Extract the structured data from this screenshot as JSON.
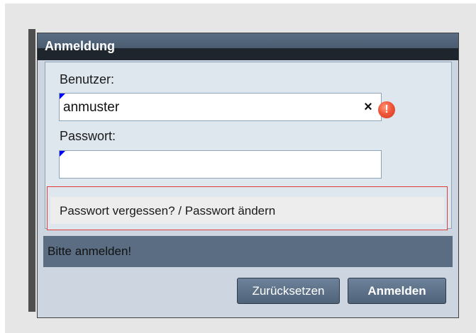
{
  "dialog": {
    "title": "Anmeldung"
  },
  "form": {
    "user_label": "Benutzer:",
    "user_value": "anmuster",
    "clear_icon": "×",
    "error_icon": "!",
    "password_label": "Passwort:",
    "password_value": ""
  },
  "links": {
    "forgot_password": "Passwort vergessen? / Passwort ändern"
  },
  "status": {
    "message": "Bitte anmelden!"
  },
  "buttons": {
    "reset_label": "Zurücksetzen",
    "login_label": "Anmelden"
  },
  "colors": {
    "title_bar": "#4b5c70",
    "status_bar": "#5a6d83",
    "error": "#f0563b",
    "field_marker": "#0000ff",
    "link_box_border": "#e03c3c"
  },
  "icons": {
    "clear": "close-icon",
    "error": "error-icon"
  }
}
